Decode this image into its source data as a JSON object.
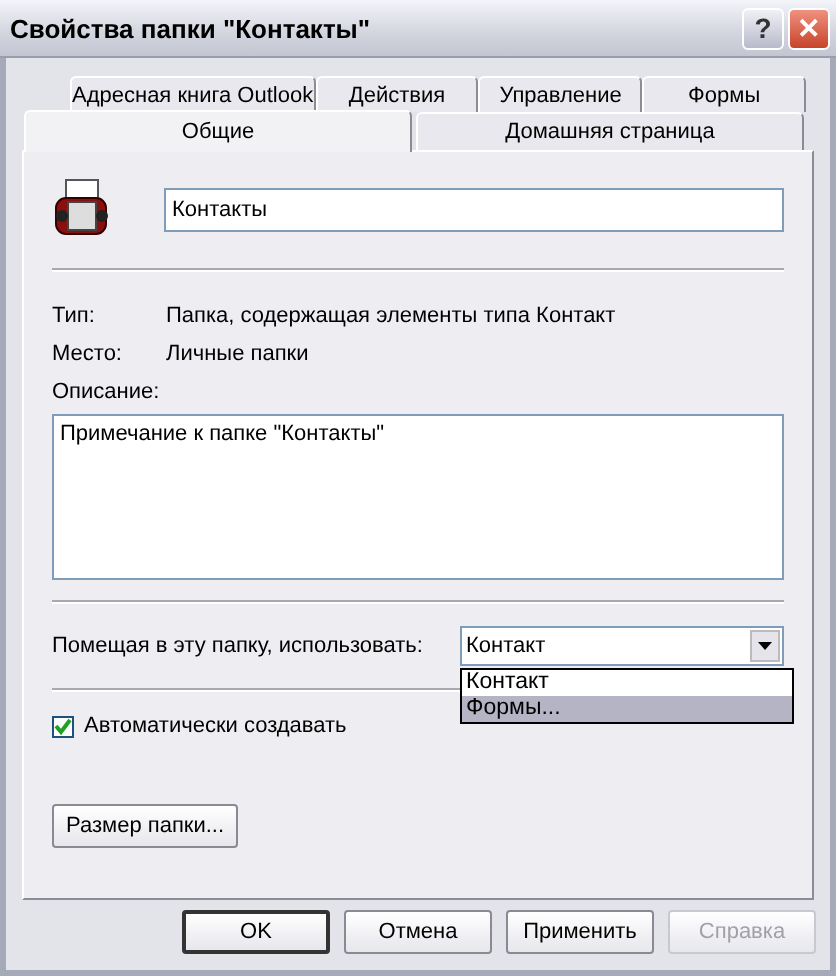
{
  "window": {
    "title": "Свойства папки \"Контакты\"",
    "buttons": [
      {
        "kind": "help",
        "label": "?"
      },
      {
        "kind": "close",
        "label": "✕"
      }
    ]
  },
  "tabs": [
    [
      {
        "label": "Адресная книга Outlook",
        "selected": false
      },
      {
        "label": "Действия",
        "selected": false
      },
      {
        "label": "Управление",
        "selected": false
      },
      {
        "label": "Формы",
        "selected": false
      }
    ],
    [
      {
        "label": "Общие",
        "selected": true
      },
      {
        "label": "Домашняя страница",
        "selected": false
      }
    ]
  ],
  "general": {
    "name": "Контакты",
    "info": [
      {
        "label": "Тип:",
        "value": "Папка, содержащая элементы типа Контакт"
      },
      {
        "label": "Место:",
        "value": "Личные папки"
      }
    ],
    "description_label": "Описание:",
    "description": "Примечание к папке \"Контакты\"",
    "post_label": "Помещая в эту папку, использовать:",
    "post_value": "Контакт",
    "post_options": [
      {
        "label": "Контакт",
        "selected": false
      },
      {
        "label": "Формы...",
        "selected": true
      }
    ],
    "auto_views": {
      "label": "Автоматически создавать",
      "checked": true
    },
    "folder_size_button": "Размер папки..."
  },
  "buttons": [
    {
      "label": "OK",
      "default": true,
      "disabled": false
    },
    {
      "label": "Отмена",
      "default": false,
      "disabled": false
    },
    {
      "label": "Применить",
      "default": false,
      "disabled": false
    },
    {
      "label": "Справка",
      "default": false,
      "disabled": true
    }
  ]
}
